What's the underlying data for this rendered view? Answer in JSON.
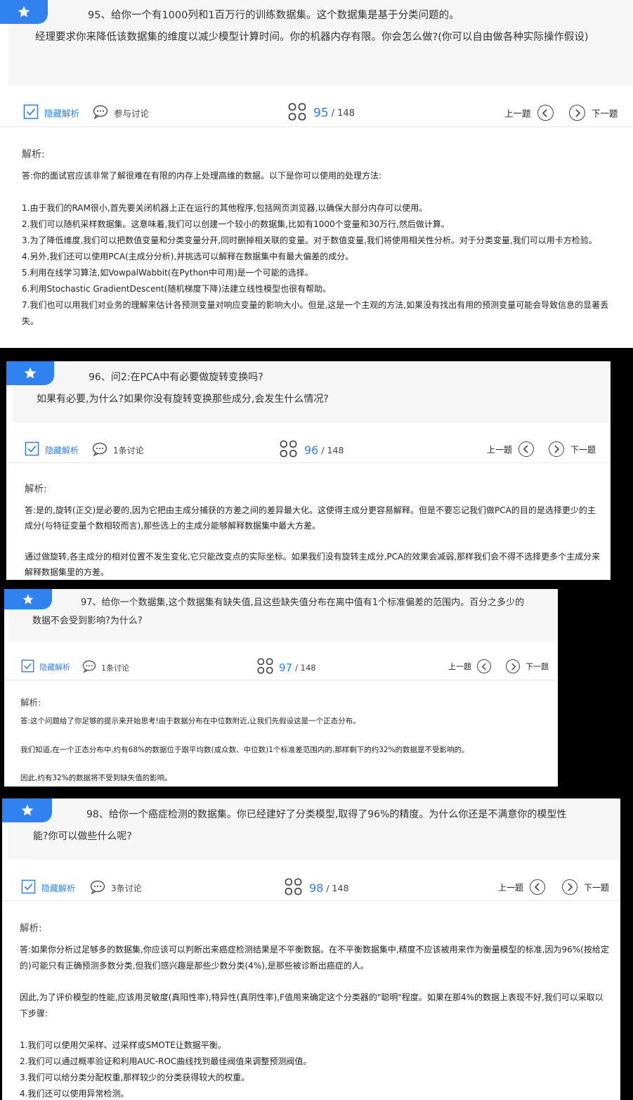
{
  "common": {
    "hide_analysis": "隐藏解析",
    "prev": "上一题",
    "next": "下一题",
    "total": "/ 148",
    "analysis_label": "解析:"
  },
  "q95": {
    "title": "95、给你一个有1000列和1百万行的训练数据集。这个数据集是基于分类问题的。",
    "sub": "经理要求你来降低该数据集的维度以减少模型计算时间。你的机器内存有限。你会怎么做?(你可以自由做各种实际操作假设)",
    "discuss": "参与讨论",
    "num": "95",
    "a0": "答:你的面试官应该非常了解很难在有限的内存上处理高维的数据。以下是你可以使用的处理方法:",
    "a1": "1.由于我们的RAM很小,首先要关闭机器上正在运行的其他程序,包括网页浏览器,以确保大部分内存可以使用。",
    "a2": "2.我们可以随机采样数据集。这意味着,我们可以创建一个较小的数据集,比如有1000个变量和30万行,然后做计算。",
    "a3": "3.为了降低维度,我们可以把数值变量和分类变量分开,同时删掉相关联的变量。对于数值变量,我们将使用相关性分析。对于分类变量,我们可以用卡方检验。",
    "a4": "4.另外,我们还可以使用PCA(主成分分析),并挑选可以解释在数据集中有最大偏差的成分。",
    "a5": "5.利用在线学习算法,如VowpalWabbit(在Python中可用)是一个可能的选择。",
    "a6": "6.利用Stochastic GradientDescent(随机梯度下降)法建立线性模型也很有帮助。",
    "a7": "7.我们也可以用我们对业务的理解来估计各预测变量对响应变量的影响大小。但是,这是一个主观的方法,如果没有找出有用的预测变量可能会导致信息的显著丢失。"
  },
  "q96": {
    "title": "96、问2:在PCA中有必要做旋转变换吗?",
    "sub": "如果有必要,为什么?如果你没有旋转变换那些成分,会发生什么情况?",
    "discuss": "1条讨论",
    "num": "96",
    "a0": "答:是的,旋转(正交)是必要的,因为它把由主成分捕获的方差之间的差异最大化。这使得主成分更容易解释。但是不要忘记我们做PCA的目的是选择更少的主成分(与特征变量个数相较而言),那些选上的主成分能够解释数据集中最大方差。",
    "a1": "通过做旋转,各主成分的相对位置不发生变化,它只能改变点的实际坐标。如果我们没有旋转主成分,PCA的效果会减弱,那样我们会不得不选择更多个主成分来解释数据集里的方差。"
  },
  "q97": {
    "title": "97、给你一个数据集,这个数据集有缺失值,且这些缺失值分布在离中值有1个标准偏差的范围内。百分之多少的",
    "sub": "数据不会受到影响?为什么?",
    "discuss": "1条讨论",
    "num": "97",
    "a0": "答:这个问题给了你足够的提示来开始思考!由于数据分布在中位数附近,让我们先假设这是一个正态分布。",
    "a1": "我们知道,在一个正态分布中,约有68%的数据位于跟平均数(或众数、中位数)1个标准差范围内的,那样剩下的约32%的数据是不受影响的。",
    "a2": "因此,约有32%的数据将不受到缺失值的影响。"
  },
  "q98": {
    "title": "98、给你一个癌症检测的数据集。你已经建好了分类模型,取得了96%的精度。为什么你还是不满意你的模型性",
    "sub": "能?你可以做些什么呢?",
    "discuss": "3条讨论",
    "num": "98",
    "a0": "答:如果你分析过足够多的数据集,你应该可以判断出来癌症检测结果是不平衡数据。在不平衡数据集中,精度不应该被用来作为衡量模型的标准,因为96%(按给定的)可能只有正确预测多数分类,但我们感兴趣是那些少数分类(4%),是那些被诊断出癌症的人。",
    "a1": "因此,为了评价模型的性能,应该用灵敏度(真阳性率),特异性(真阴性率),F值用来确定这个分类器的\"聪明\"程度。如果在那4%的数据上表现不好,我们可以采取以下步骤:",
    "a2": "1.我们可以使用欠采样、过采样或SMOTE让数据平衡。",
    "a3": "2.我们可以通过概率验证和利用AUC-ROC曲线找到最佳阀值来调整预测阀值。",
    "a4": "3.我们可以给分类分配权重,那样较少的分类获得较大的权重。",
    "a5": "4.我们还可以使用异常检测。"
  }
}
